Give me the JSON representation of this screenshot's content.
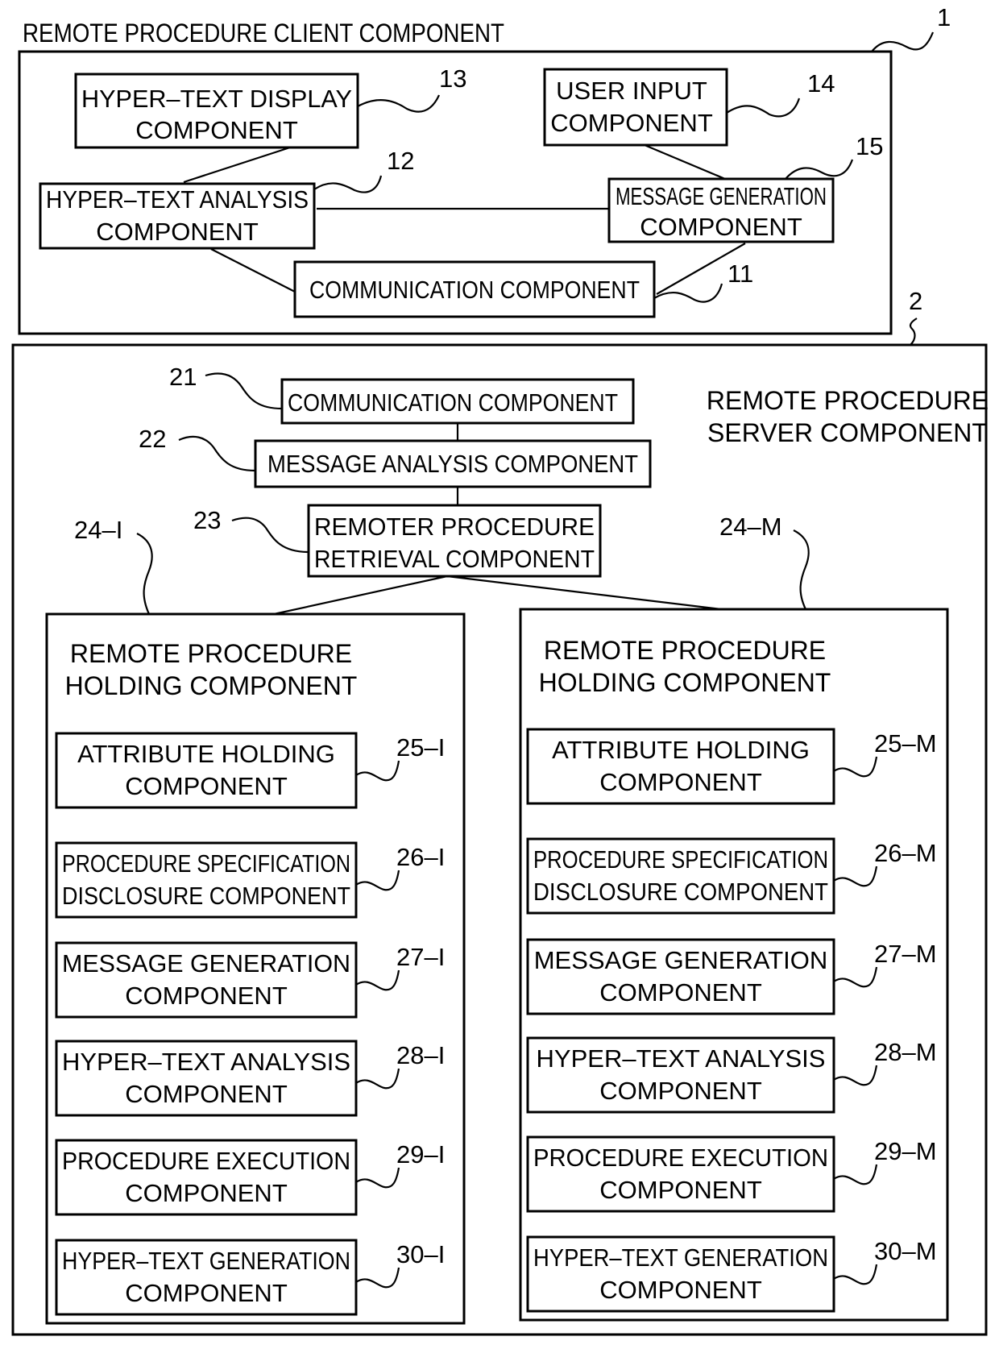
{
  "client": {
    "title": "REMOTE PROCEDURE CLIENT COMPONENT",
    "ref": "1",
    "components": {
      "hypertext_display": {
        "lines": [
          "HYPER–TEXT DISPLAY",
          "COMPONENT"
        ],
        "ref": "13"
      },
      "user_input": {
        "lines": [
          "USER INPUT",
          "COMPONENT"
        ],
        "ref": "14"
      },
      "hypertext_analysis": {
        "lines": [
          "HYPER–TEXT ANALYSIS",
          "COMPONENT"
        ],
        "ref": "12"
      },
      "message_generation": {
        "lines": [
          "MESSAGE GENERATION",
          "COMPONENT"
        ],
        "ref": "15"
      },
      "communication": {
        "lines": [
          "COMMUNICATION COMPONENT"
        ],
        "ref": "11"
      }
    }
  },
  "server": {
    "title_lines": [
      "REMOTE PROCEDURE",
      "SERVER COMPONENT"
    ],
    "ref": "2",
    "communication": {
      "label": "COMMUNICATION COMPONENT",
      "ref": "21"
    },
    "message_analysis": {
      "label": "MESSAGE ANALYSIS COMPONENT",
      "ref": "22"
    },
    "retrieval": {
      "lines": [
        "REMOTER PROCEDURE",
        "RETRIEVAL COMPONENT"
      ],
      "ref": "23"
    },
    "holding_groups": [
      {
        "ref": "24–I",
        "title_lines": [
          "REMOTE PROCEDURE",
          "HOLDING COMPONENT"
        ],
        "items": [
          {
            "lines": [
              "ATTRIBUTE HOLDING",
              "COMPONENT"
            ],
            "ref": "25–I"
          },
          {
            "lines": [
              "PROCEDURE SPECIFICATION",
              "DISCLOSURE COMPONENT"
            ],
            "ref": "26–I"
          },
          {
            "lines": [
              "MESSAGE GENERATION",
              "COMPONENT"
            ],
            "ref": "27–I"
          },
          {
            "lines": [
              "HYPER–TEXT ANALYSIS",
              "COMPONENT"
            ],
            "ref": "28–I"
          },
          {
            "lines": [
              "PROCEDURE EXECUTION",
              "COMPONENT"
            ],
            "ref": "29–I"
          },
          {
            "lines": [
              "HYPER–TEXT GENERATION",
              "COMPONENT"
            ],
            "ref": "30–I"
          }
        ]
      },
      {
        "ref": "24–M",
        "title_lines": [
          "REMOTE PROCEDURE",
          "HOLDING COMPONENT"
        ],
        "items": [
          {
            "lines": [
              "ATTRIBUTE HOLDING",
              "COMPONENT"
            ],
            "ref": "25–M"
          },
          {
            "lines": [
              "PROCEDURE SPECIFICATION",
              "DISCLOSURE COMPONENT"
            ],
            "ref": "26–M"
          },
          {
            "lines": [
              "MESSAGE GENERATION",
              "COMPONENT"
            ],
            "ref": "27–M"
          },
          {
            "lines": [
              "HYPER–TEXT ANALYSIS",
              "COMPONENT"
            ],
            "ref": "28–M"
          },
          {
            "lines": [
              "PROCEDURE EXECUTION",
              "COMPONENT"
            ],
            "ref": "29–M"
          },
          {
            "lines": [
              "HYPER–TEXT GENERATION",
              "COMPONENT"
            ],
            "ref": "30–M"
          }
        ]
      }
    ]
  }
}
